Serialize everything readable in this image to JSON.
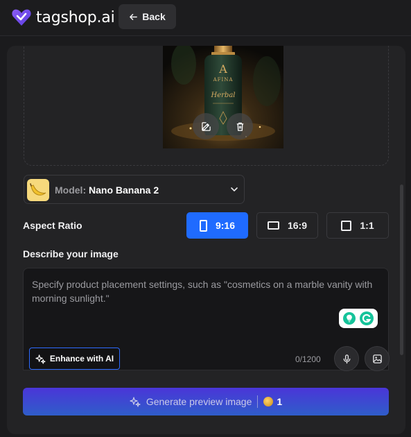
{
  "header": {
    "brand": "tagshop.ai",
    "back_label": "Back"
  },
  "preview": {
    "brand_monogram": "A",
    "brand_name": "AFINA",
    "script_word": "Herbal",
    "edit_icon": "edit-icon",
    "delete_icon": "trash-icon"
  },
  "model": {
    "label": "Model:",
    "value": "Nano Banana 2"
  },
  "aspect": {
    "label": "Aspect Ratio",
    "options": [
      {
        "label": "9:16",
        "selected": true
      },
      {
        "label": "16:9",
        "selected": false
      },
      {
        "label": "1:1",
        "selected": false
      }
    ]
  },
  "describe": {
    "label": "Describe your image",
    "placeholder": "Specify product placement settings, such as \"cosmetics on a marble vanity with morning sunlight.\"",
    "counter": "0/1200",
    "enhance_label": "Enhance with AI"
  },
  "generate": {
    "label": "Generate preview image",
    "credits": "1"
  },
  "colors": {
    "accent": "#1f6bff",
    "brand": "#6c4cf5",
    "generate_gradient_top": "#4a35d8",
    "generate_gradient_bottom": "#2f5dc9"
  }
}
